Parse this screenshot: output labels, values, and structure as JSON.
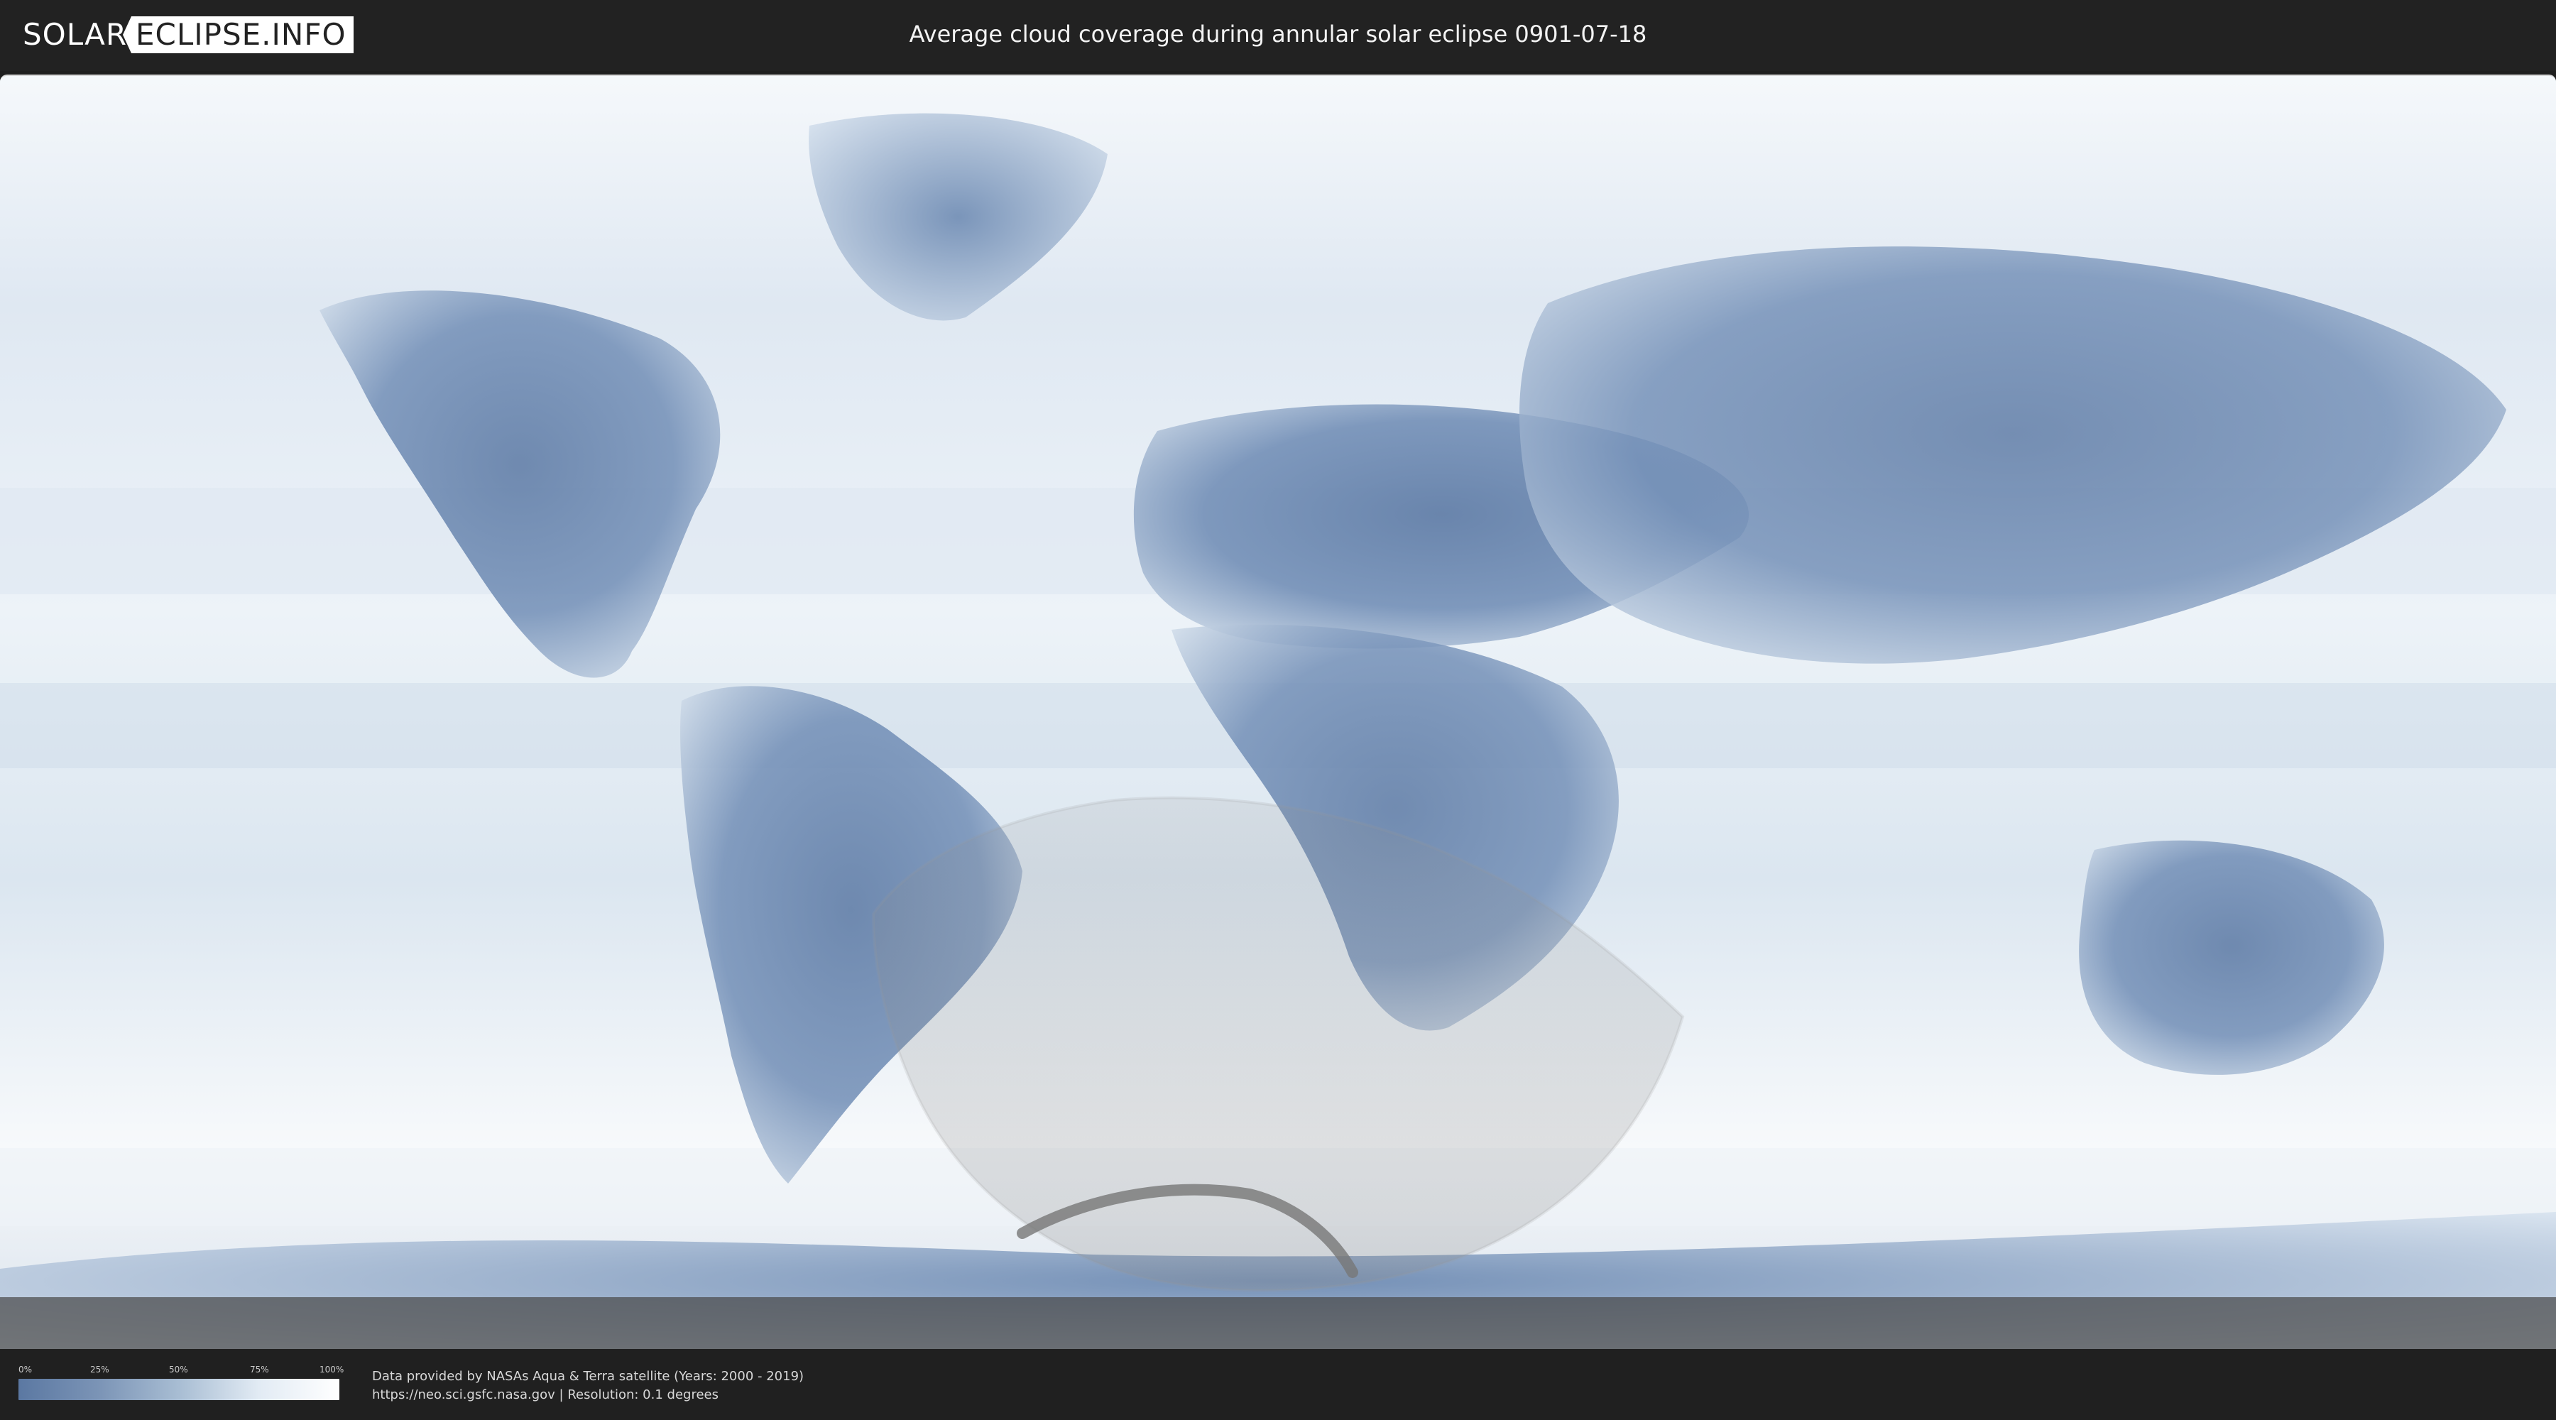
{
  "logo": {
    "left": "SOLAR",
    "right": "ECLIPSE.INFO"
  },
  "header": {
    "title": "Average cloud coverage during annular solar eclipse 0901-07-18"
  },
  "legend": {
    "ticks": [
      "0%",
      "25%",
      "50%",
      "75%",
      "100%"
    ]
  },
  "footer": {
    "credit_line_1": "Data provided by NASAs Aqua & Terra satellite (Years: 2000 - 2019)",
    "credit_line_2": "https://neo.sci.gsfc.nasa.gov | Resolution: 0.1 degrees"
  },
  "colors": {
    "page_background": "#1f1f1f",
    "header_background": "#222222",
    "footer_background": "#202020",
    "ocean_cloud": "#dde8f2",
    "land_cloud": "#6b86ae",
    "eclipse_overlay": "#bdbdbd",
    "eclipse_shadow": "#7a7a7a",
    "title_text": "#f3f3f3",
    "credits_text": "#d8d8d8"
  },
  "icons": {
    "logo_mark": "logo-wordmark"
  }
}
